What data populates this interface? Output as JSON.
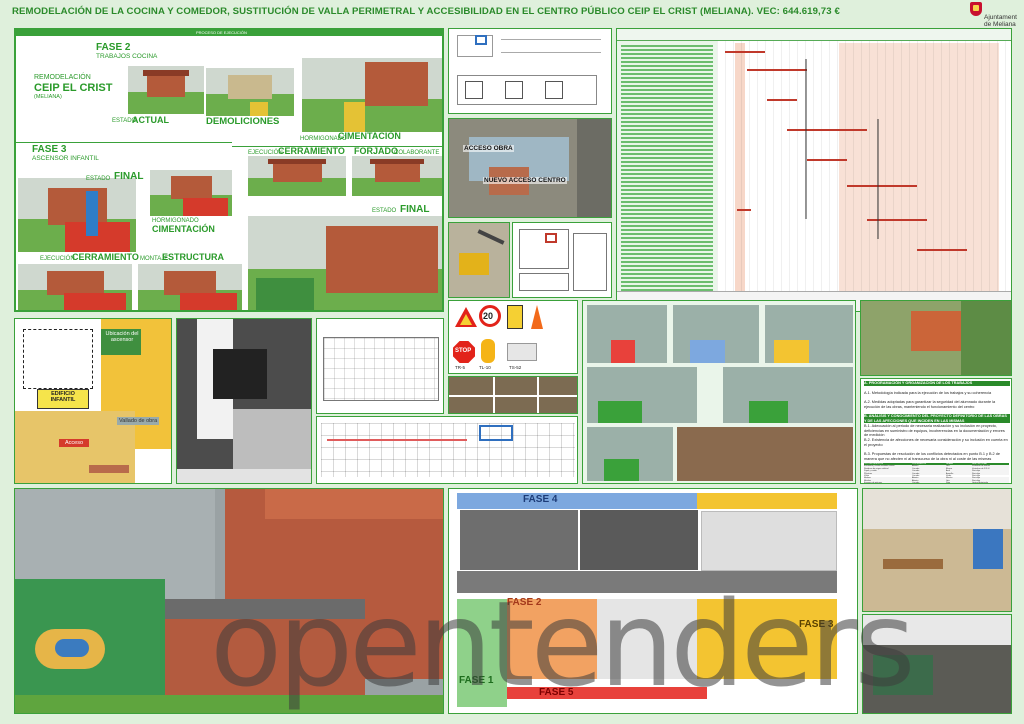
{
  "header": {
    "title": "REMODELACIÓN DE LA COCINA Y COMEDOR, SUSTITUCIÓN DE VALLA PERIMETRAL Y ACCESIBILIDAD EN EL CENTRO PÚBLICO CEIP EL CRIST (MELIANA).  VEC: 644.619,73 €",
    "logo_line1": "Ajuntament",
    "logo_line2": "de Meliana"
  },
  "phases_panel": {
    "top_bar": "PROCESO DE EJECUCIÓN",
    "project_line1": "REMODELACIÓN",
    "project_line2": "CEIP EL CRIST",
    "project_line3": "(MELIANA)",
    "fase2_title": "FASE 2",
    "fase2_sub": "TRABAJOS COCINA",
    "estado_actual_small": "ESTADO",
    "estado_actual_big": "ACTUAL",
    "demoliciones": "DEMOLICIONES",
    "hormigonado_small": "HORMIGONADO",
    "cimentacion": "CIMENTACIÓN",
    "ejecucion_small": "EJECUCIÓN",
    "cerramiento": "CERRAMIENTO",
    "forjado": "FORJADO",
    "colaborante_small": "COLABORANTE",
    "estado_final_small": "ESTADO",
    "estado_final_big": "FINAL",
    "fase3_title": "FASE 3",
    "fase3_sub": "ASCENSOR INFANTIL",
    "estado_small2": "ESTADO",
    "final2": "FINAL",
    "hormigonado_small2": "HORMIGONADO",
    "cimentacion2": "CIMENTACIÓN",
    "ejecucion_small2": "EJECUCIÓN",
    "cerramiento2": "CERRAMIENTO",
    "montaje_small": "MONTAJE",
    "estructura": "ESTRUCTURA"
  },
  "aerial": {
    "label1": "ACCESO OBRA",
    "label2": "NUEVO ACCESO CENTRO"
  },
  "elevator_plan": {
    "label1": "Ubicación del ascensor",
    "label2": "EDIFICIO INFANTIL",
    "label3": "Acceso",
    "label4": "Vallado de obra"
  },
  "signs": {
    "speed": "20",
    "stop": "STOP",
    "caption1": "TR-5",
    "caption2": "TL-10",
    "caption3": "TS-52"
  },
  "text_panel": {
    "lines": [
      "A. PROGRAMACIÓN Y ORGANIZACIÓN DE LOS TRABAJOS",
      "A.1. Metodología indicada para la ejecución de los trabajos y su coherencia",
      "A.2. Medidas adoptadas para garantizar la seguridad del alumnado durante la ejecución de las obras, manteniendo el funcionamiento del centro",
      "B. ANÁLISIS Y CONOCIMIENTO DEL PROYECTO DEFINITORIO DE LAS OBRAS Y DE LAS AFECCIONES QUE INCIDEN EN LAS MISMAS",
      "B.1. Adecuación al periodo de necesaria realización y su inclusión en proyecto, deficiencias en suministro de equipos, incoherencias en la documentación y errores de medición",
      "B.2. Existencia de afecciones de necesaria consideración y su inclusión en cuenta en el proyecto",
      "B.3. Propuestas de resolución de los conflictos detectados en punto B.1 y B.2 de manera que no afecten ni al transcurso de la obra ni al coste de las mismas"
    ],
    "table_header": [
      "TIPO DE RESIDUOS",
      "CONTENEDOR",
      "GRAVA",
      "DESTINO FINAL"
    ],
    "table_rows": [
      [
        "Escombro y restos metales mixtos",
        "Abierto",
        "Gris",
        "Vertedero de inertes"
      ],
      [
        "Residuos de origen artificial",
        "Cerrado",
        "Blanco",
        "Vertedero de R.S.U."
      ],
      [
        "Papel y cartón",
        "Cerrado",
        "Azul",
        "Reciclaje"
      ],
      [
        "Plásticos",
        "Cerrado",
        "Amarillo",
        "Reciclaje"
      ],
      [
        "Vidrio",
        "Cerrado",
        "Verde",
        "Reciclaje"
      ],
      [
        "Madera",
        "Abierto",
        "Marrón",
        "Reciclaje"
      ],
      [
        "Metales",
        "Abierto",
        "Gris",
        "Reciclaje"
      ],
      [
        "Envases de pinturas",
        "Cerrado",
        "Rojo",
        "Gestor Autorizado"
      ]
    ]
  },
  "zones": {
    "fase4": "FASE 4",
    "fase2": "FASE 2",
    "fase3": "FASE 3",
    "fase1": "FASE 1",
    "fase5": "FASE 5"
  },
  "watermark": "opentenders",
  "colors": {
    "accent_green": "#3aa13a",
    "label_green": "#2a9a2a",
    "brick": "#b45a3a",
    "court_red": "#d53a2b",
    "zone_blue": "#7da8df",
    "zone_yellow": "#f3c431",
    "zone_green": "#8fd18a",
    "zone_orange": "#f2a262",
    "zone_red": "#e8413b"
  }
}
